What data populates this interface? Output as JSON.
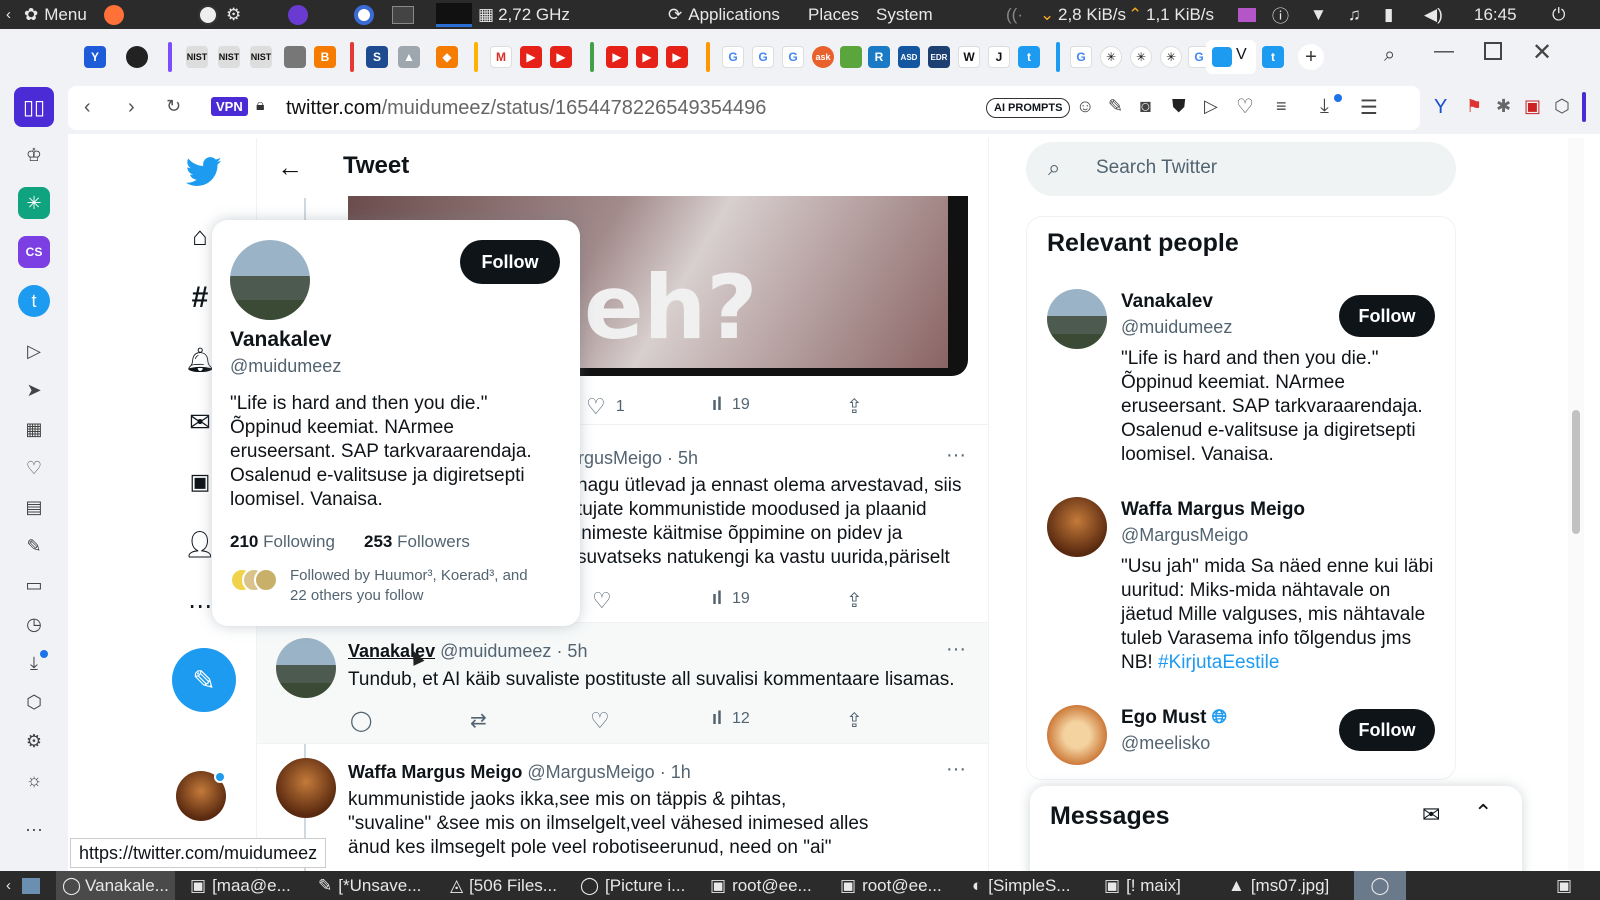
{
  "system_panel": {
    "menu": "Menu",
    "cpu": "2,72 GHz",
    "applications": "Applications",
    "places": "Places",
    "system": "System",
    "net_down": "2,8 KiB/s",
    "net_up": "1,1 KiB/s",
    "time": "16:45"
  },
  "browser": {
    "vpn": "VPN",
    "url_host": "twitter.com",
    "url_path": "/muidumeez/status/1654478226549354496",
    "ai_prompts": "AI PROMPTS",
    "status_url": "https://twitter.com/muidumeez"
  },
  "header": {
    "title": "Tweet"
  },
  "search": {
    "placeholder": "Search Twitter"
  },
  "media": {
    "caption": "eh?"
  },
  "tweet_top": {
    "likes": "1",
    "views": "19"
  },
  "tweet2": {
    "handle_time": "rgusMeigo · 5h",
    "lines": [
      "nagu ütlevad ja ennast olema arvestavad, siis",
      "tujate kommunistide moodused ja plaanid",
      "inimeste käitmise õppimine on pidev ja",
      "suvatseks natukengi ka vastu uurida,päriselt"
    ],
    "views": "19"
  },
  "tweet3": {
    "name": "Vanakalev",
    "handle": "@muidumeez",
    "time": "· 5h",
    "text": "Tundub, et AI käib suvaliste postituste all suvalisi kommentaare lisamas.",
    "views": "12"
  },
  "tweet4": {
    "name": "Waffa Margus Meigo",
    "handle": "@MargusMeigo",
    "time": "· 1h",
    "lines": [
      "kummunistide jaoks ikka,see mis on täppis & pihtas,",
      "\"suvaline\" &see mis on ilmselgelt,veel vähesed inimesed alles",
      "änud kes ilmsegelt pole veel robotiseerunud, need on \"ai\""
    ]
  },
  "hovercard": {
    "follow": "Follow",
    "name": "Vanakalev",
    "handle": "@muidumeez",
    "bio": [
      "\"Life is hard and then you die.\"",
      "Õppinud keemiat. NArmee",
      "eruseersant.  SAP tarkvaraarendaja.",
      "Osalenud e-valitsuse ja digiretsepti",
      "loomisel. Vanaisa."
    ],
    "following_count": "210",
    "following_label": "Following",
    "followers_count": "253",
    "followers_label": "Followers",
    "followed_by": [
      "Followed by Huumor³, Koerad³, and",
      "22 others you follow"
    ]
  },
  "relevant": {
    "title": "Relevant people",
    "people": [
      {
        "name": "Vanakalev",
        "handle": "@muidumeez",
        "follow": "Follow",
        "bio": [
          "\"Life is hard and then you die.\"",
          "Õppinud keemiat. NArmee",
          "eruseersant. SAP tarkvaraarendaja.",
          "Osalenud e-valitsuse ja digiretsepti",
          "loomisel. Vanaisa."
        ]
      },
      {
        "name": "Waffa Margus Meigo",
        "handle": "@MargusMeigo",
        "bio": [
          "\"Usu jah\" mida Sa näed enne kui läbi",
          "uuritud: Miks-mida nähtavale on",
          "jäetud Mille valguses, mis nähtavale",
          "tuleb Varasema info tõlgendus jms"
        ],
        "bio_last": "NB! ",
        "hashtag": "#KirjutaEestile"
      },
      {
        "name": "Ego Must",
        "handle": "@meelisko",
        "follow": "Follow"
      }
    ]
  },
  "messages": {
    "title": "Messages"
  },
  "taskbar": [
    "Vanakale...",
    "[maa@e...",
    "[*Unsave...",
    "[506 Files...",
    "[Picture i...",
    "root@ee...",
    "root@ee...",
    "[SimpleS...",
    "[! maix]",
    "[ms07.jpg]"
  ],
  "colors": {
    "twitter_blue": "#1d9bf0",
    "panel": "#2b2b2b",
    "text": "#0f1419",
    "muted": "#536471"
  }
}
